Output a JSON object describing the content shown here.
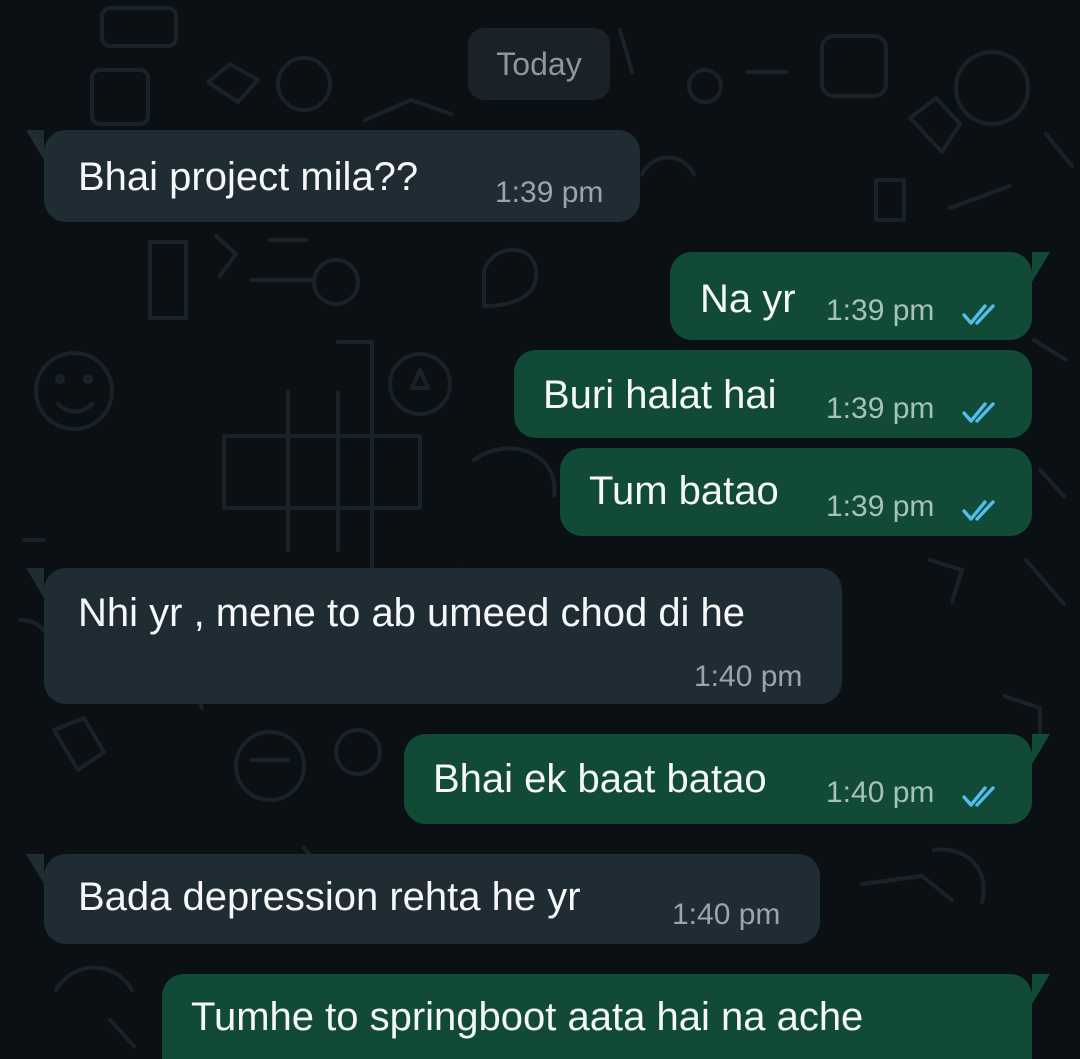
{
  "date_chip": "Today",
  "messages": [
    {
      "direction": "incoming",
      "text": "Bhai project mila??",
      "time": "1:39 pm"
    },
    {
      "direction": "outgoing",
      "text": "Na yr",
      "time": "1:39 pm",
      "status": "read"
    },
    {
      "direction": "outgoing",
      "text": "Buri halat hai",
      "time": "1:39 pm",
      "status": "read"
    },
    {
      "direction": "outgoing",
      "text": "Tum batao",
      "time": "1:39 pm",
      "status": "read"
    },
    {
      "direction": "incoming",
      "text": "Nhi yr , mene to ab umeed chod di he",
      "time": "1:40 pm"
    },
    {
      "direction": "outgoing",
      "text": "Bhai ek baat batao",
      "time": "1:40 pm",
      "status": "read"
    },
    {
      "direction": "incoming",
      "text": "Bada depression rehta he yr",
      "time": "1:40 pm"
    },
    {
      "direction": "outgoing",
      "text": "Tumhe to springboot aata hai na ache",
      "time": "",
      "status": ""
    }
  ],
  "colors": {
    "background": "#0b1014",
    "incoming_bubble": "#1f2c33",
    "outgoing_bubble": "#114b37",
    "read_ticks": "#53bdeb"
  },
  "icons": {
    "read_receipt": "double-check-icon"
  }
}
